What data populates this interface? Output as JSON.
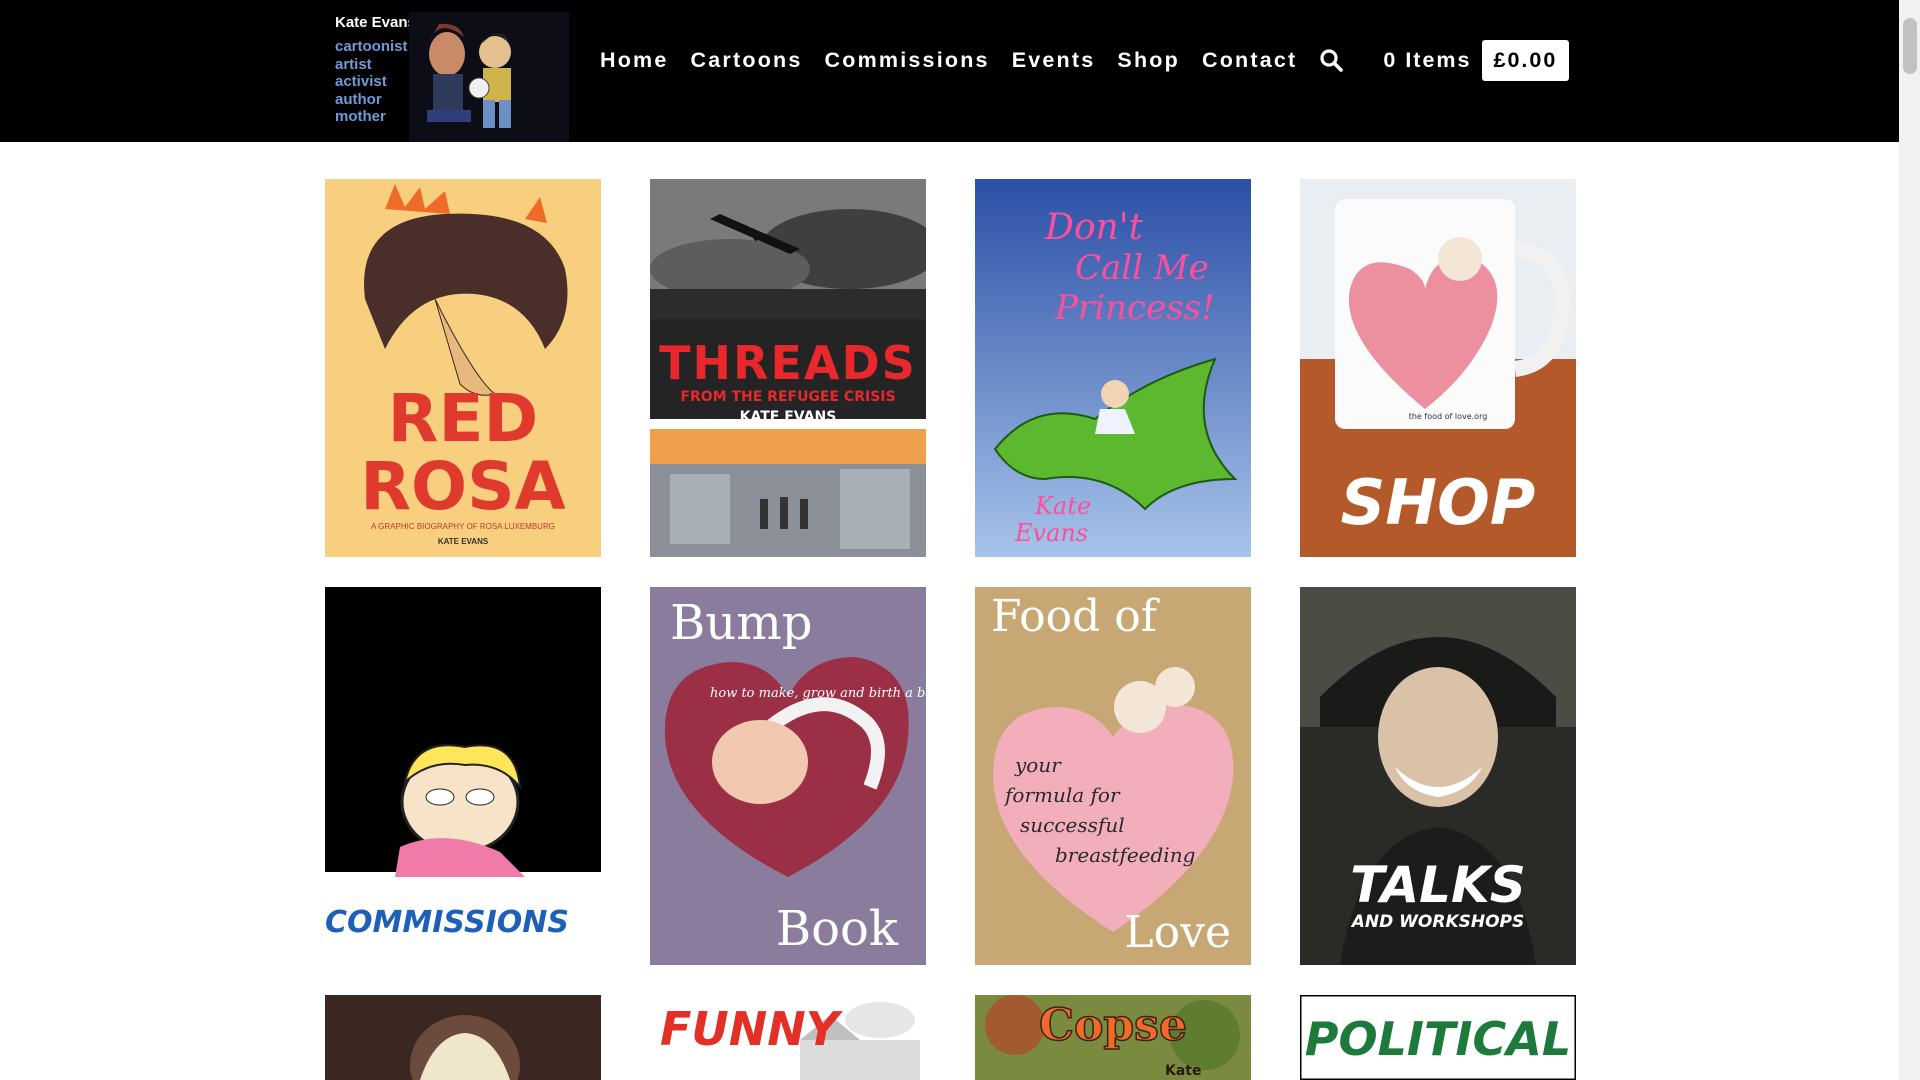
{
  "brand": {
    "name": "Kate Evans",
    "roles": [
      "cartoonist",
      "artist",
      "activist",
      "author",
      "mother"
    ]
  },
  "nav": {
    "items": [
      "Home",
      "Cartoons",
      "Commissions",
      "Events",
      "Shop",
      "Contact"
    ],
    "search_icon": "search-icon"
  },
  "cart": {
    "items_label": "0 Items",
    "total": "£0.00"
  },
  "tiles": [
    {
      "title_line1": "RED",
      "title_line2": "ROSA",
      "sub": "A GRAPHIC BIOGRAPHY OF ROSA LUXEMBURG",
      "author": "KATE EVANS"
    },
    {
      "title": "THREADS",
      "sub": "FROM THE REFUGEE CRISIS",
      "author": "KATE EVANS"
    },
    {
      "title_line1": "Don't",
      "title_line2": "Call Me",
      "title_line3": "Princess!",
      "author_line1": "Kate",
      "author_line2": "Evans"
    },
    {
      "caption": "the food of love.org",
      "label": "SHOP"
    },
    {
      "label": "COMMISSIONS"
    },
    {
      "title_top": "Bump",
      "title_bottom": "Book",
      "arc": "how to make, grow and birth a baby"
    },
    {
      "title_top": "Food of",
      "title_bottom": "Love",
      "script_line1": "your",
      "script_line2": "formula for",
      "script_line3": "successful",
      "script_line4": "breastfeeding"
    },
    {
      "label": "TALKS",
      "sublabel": "AND WORKSHOPS"
    },
    {},
    {
      "label": "FUNNY"
    },
    {
      "title": "Copse",
      "author": "Kate"
    },
    {
      "label": "POLITICAL"
    }
  ]
}
